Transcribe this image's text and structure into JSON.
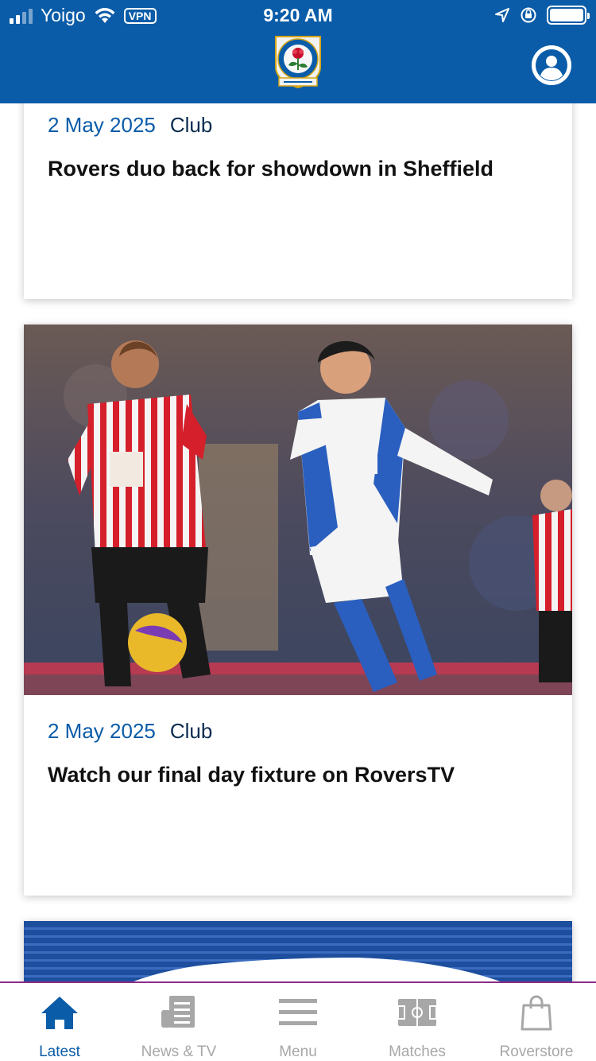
{
  "status_bar": {
    "carrier": "Yoigo",
    "vpn": "VPN",
    "time": "9:20 AM"
  },
  "header": {
    "crest_lettering": "BLACKBURN ROVERS · ARTE ET LABORE"
  },
  "feed": {
    "articles": [
      {
        "date": "2 May 2025",
        "category": "Club",
        "title": "Rovers duo back for showdown in Sheffield"
      },
      {
        "date": "2 May 2025",
        "category": "Club",
        "title": "Watch our final day fixture on RoversTV"
      }
    ]
  },
  "tabs": [
    {
      "label": "Latest",
      "icon": "home-icon",
      "active": true
    },
    {
      "label": "News & TV",
      "icon": "newspaper-icon",
      "active": false
    },
    {
      "label": "Menu",
      "icon": "hamburger-menu-icon",
      "active": false
    },
    {
      "label": "Matches",
      "icon": "pitch-icon",
      "active": false
    },
    {
      "label": "Roverstore",
      "icon": "shopping-bag-icon",
      "active": false
    }
  ],
  "colors": {
    "brand_blue": "#0a5ca8",
    "date_blue": "#0a5ca8",
    "category_navy": "#0b2d52",
    "tab_inactive": "#a7a7a7",
    "tab_divider": "#8b2c8b"
  }
}
